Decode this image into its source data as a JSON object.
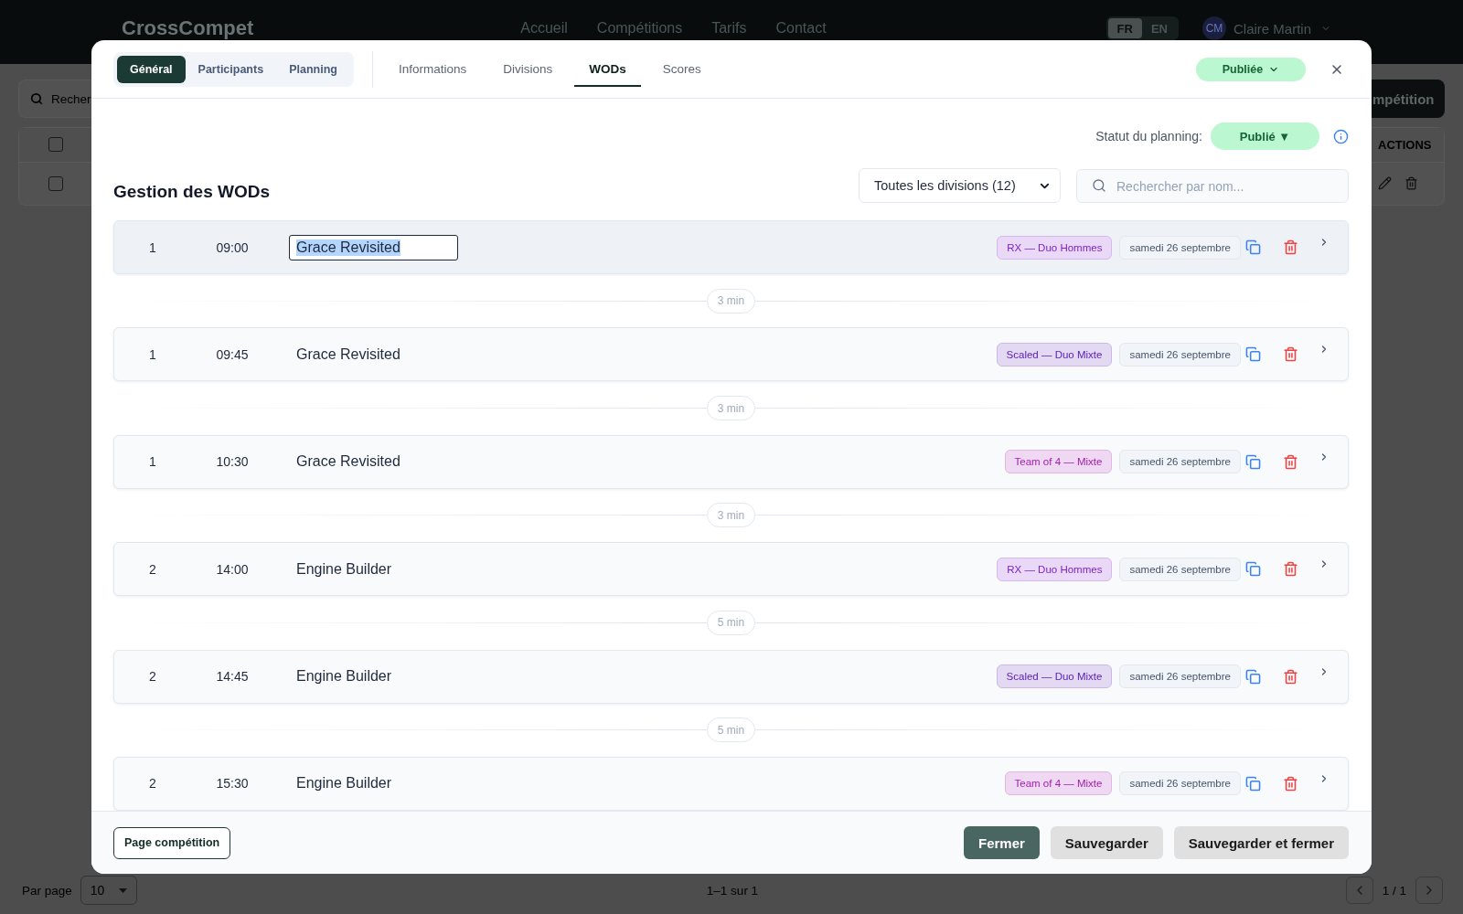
{
  "background_page": {
    "nav": {
      "logo": "CrossCompet",
      "links": [
        "Accueil",
        "Compétitions",
        "Tarifs",
        "Contact"
      ],
      "languages": [
        {
          "label": "FR",
          "selected": true
        },
        {
          "label": "EN",
          "selected": false
        }
      ],
      "user": {
        "initials": "CM",
        "name": "Claire Martin"
      }
    },
    "search": {
      "placeholder": "Recher"
    },
    "action_button": "mpétition",
    "table": {
      "header_checked": false,
      "actions_header": "ACTIONS",
      "rows": [
        {
          "checked": false
        }
      ]
    },
    "pagination": {
      "per_page_label": "Par page",
      "per_page": "10",
      "range": "1–1 sur 1",
      "page": "1 / 1"
    }
  },
  "modal": {
    "section_tabs": [
      {
        "label": "Général",
        "selected": true
      },
      {
        "label": "Participants",
        "selected": false
      },
      {
        "label": "Planning",
        "selected": false
      }
    ],
    "tabs": [
      {
        "label": "Informations",
        "selected": false
      },
      {
        "label": "Divisions",
        "selected": false
      },
      {
        "label": "WODs",
        "selected": true
      },
      {
        "label": "Scores",
        "selected": false
      }
    ],
    "status": "Publiée",
    "planning_status": {
      "label": "Statut du planning:",
      "value": "Publié ▼"
    },
    "title": "Gestion des WODs",
    "division_filter": "Toutes les divisions (12)",
    "search": {
      "placeholder": "Rechercher par nom..."
    },
    "wods": [
      {
        "round": "1",
        "time": "09:00",
        "name": "Grace Revisited",
        "editing": true,
        "division": {
          "label": "RX — Duo Hommes",
          "color": "#7e22ce"
        },
        "date": "samedi 26 septembre",
        "break_after": "3 min"
      },
      {
        "round": "1",
        "time": "09:45",
        "name": "Grace Revisited",
        "editing": false,
        "division": {
          "label": "Scaled — Duo Mixte",
          "color": "#5b21b6"
        },
        "date": "samedi 26 septembre",
        "break_after": "3 min"
      },
      {
        "round": "1",
        "time": "10:30",
        "name": "Grace Revisited",
        "editing": false,
        "division": {
          "label": "Team of 4 — Mixte",
          "color": "#a21caf"
        },
        "date": "samedi 26 septembre",
        "break_after": "3 min"
      },
      {
        "round": "2",
        "time": "14:00",
        "name": "Engine Builder",
        "editing": false,
        "division": {
          "label": "RX — Duo Hommes",
          "color": "#7e22ce"
        },
        "date": "samedi 26 septembre",
        "break_after": "5 min"
      },
      {
        "round": "2",
        "time": "14:45",
        "name": "Engine Builder",
        "editing": false,
        "division": {
          "label": "Scaled — Duo Mixte",
          "color": "#5b21b6"
        },
        "date": "samedi 26 septembre",
        "break_after": "5 min"
      },
      {
        "round": "2",
        "time": "15:30",
        "name": "Engine Builder",
        "editing": false,
        "division": {
          "label": "Team of 4 — Mixte",
          "color": "#a21caf"
        },
        "date": "samedi 26 septembre"
      }
    ],
    "footer": {
      "page_button": "Page compétition",
      "buttons": [
        {
          "label": "Fermer",
          "kind": "primary"
        },
        {
          "label": "Sauvegarder",
          "kind": "secondary"
        },
        {
          "label": "Sauvegarder et fermer",
          "kind": "secondary"
        }
      ]
    }
  }
}
